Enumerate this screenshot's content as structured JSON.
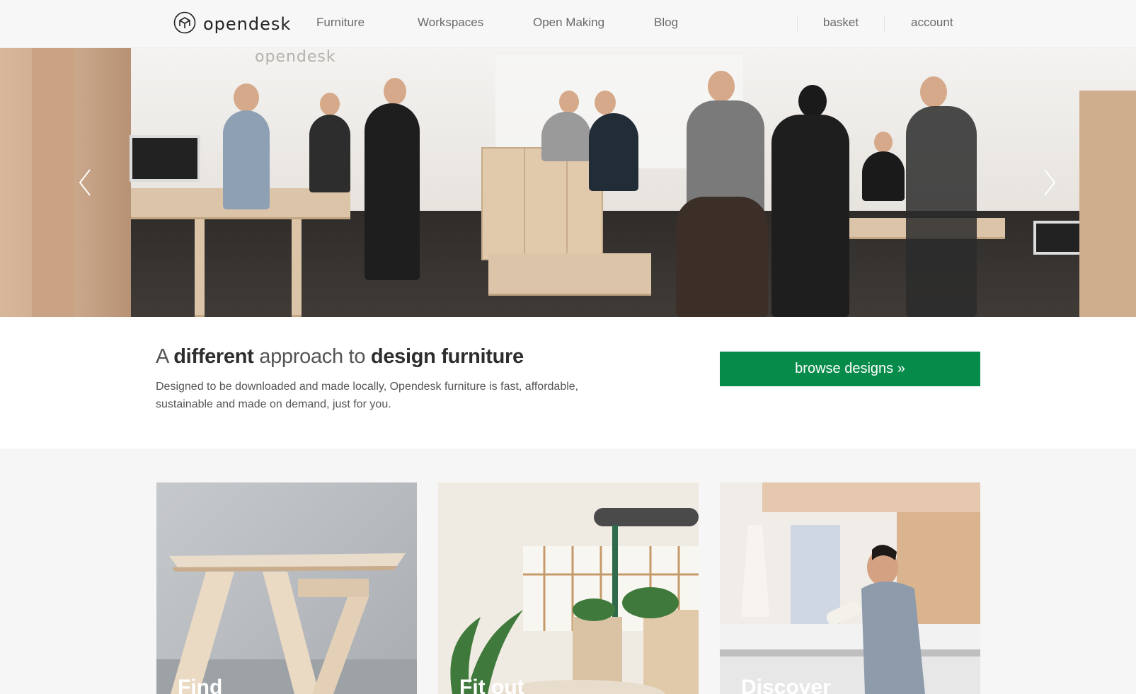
{
  "header": {
    "logo_text": "opendesk",
    "logo_icon": "opendesk-logo-icon",
    "nav": [
      "Furniture",
      "Workspaces",
      "Open Making",
      "Blog"
    ],
    "basket": "basket",
    "account": "account"
  },
  "hero": {
    "wall_brand": "opendesk",
    "prev_icon": "chevron-left-icon",
    "next_icon": "chevron-right-icon"
  },
  "intro": {
    "title_1": "A ",
    "title_2": "different",
    "title_3": " approach to ",
    "title_4": "design furniture",
    "text": "Designed to be downloaded and made locally, Opendesk furniture is fast, affordable, sustainable and made on demand, just for you.",
    "button": "browse designs »"
  },
  "cards": [
    {
      "label": "Find"
    },
    {
      "label": "Fit out"
    },
    {
      "label": "Discover"
    }
  ],
  "colors": {
    "accent": "#078b4a",
    "header_bg": "#f7f7f7",
    "nav_text": "#6a6a6a"
  }
}
